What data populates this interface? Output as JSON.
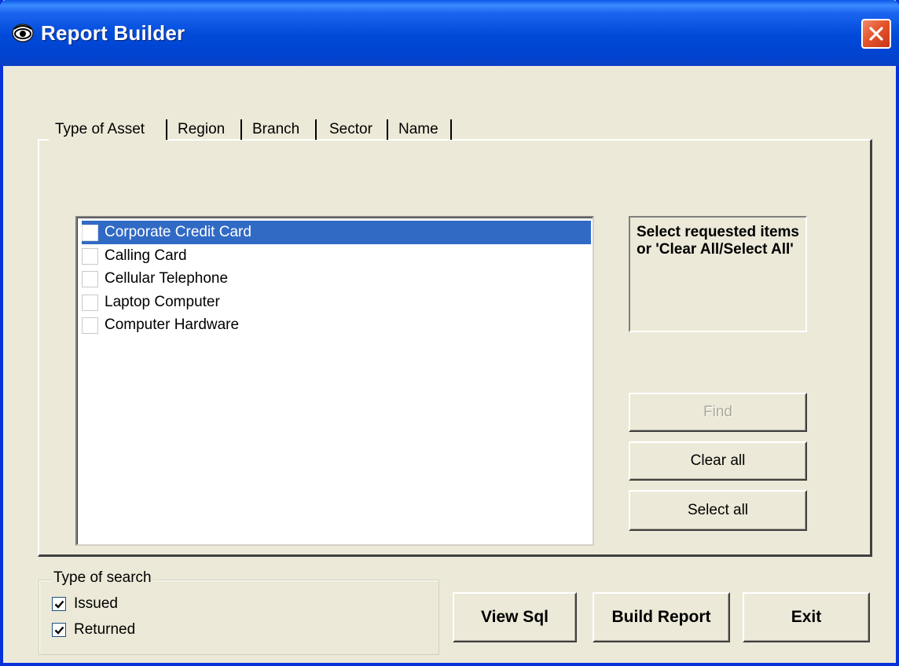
{
  "window": {
    "title": "Report Builder"
  },
  "tabs": [
    {
      "label": "Type of Asset",
      "active": true
    },
    {
      "label": "Region",
      "active": false
    },
    {
      "label": "Branch",
      "active": false
    },
    {
      "label": "Sector",
      "active": false
    },
    {
      "label": "Name",
      "active": false
    }
  ],
  "asset_list": {
    "items": [
      {
        "label": "Corporate Credit Card",
        "checked": false,
        "selected": true
      },
      {
        "label": "Calling Card",
        "checked": false,
        "selected": false
      },
      {
        "label": "Cellular Telephone",
        "checked": false,
        "selected": false
      },
      {
        "label": "Laptop Computer",
        "checked": false,
        "selected": false
      },
      {
        "label": "Computer Hardware",
        "checked": false,
        "selected": false
      }
    ]
  },
  "info": {
    "text": "Select requested items or 'Clear All/Select All'"
  },
  "panel_buttons": {
    "find": "Find",
    "clear_all": "Clear all",
    "select_all": "Select all"
  },
  "search_type": {
    "label": "Type of search",
    "issued": {
      "label": "Issued",
      "checked": true
    },
    "returned": {
      "label": "Returned",
      "checked": true
    }
  },
  "actions": {
    "view_sql": "View Sql",
    "build_report": "Build Report",
    "exit": "Exit"
  },
  "colors": {
    "title_bar": "#0049d8",
    "selection": "#316ac5",
    "close_button": "#e5552c",
    "dialog_bg": "#ece9d8"
  },
  "icons": {
    "title": "eye-icon",
    "close": "close-icon",
    "check": "checkmark-icon"
  }
}
